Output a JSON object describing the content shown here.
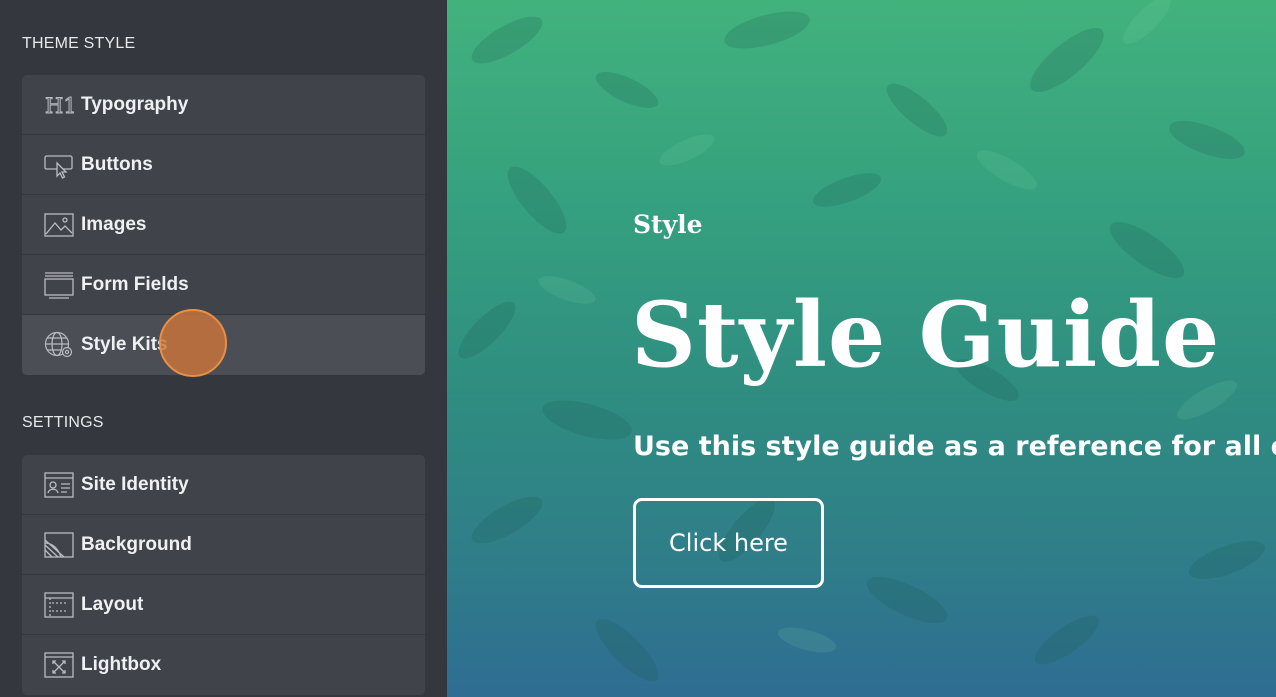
{
  "sidebar": {
    "theme_style": {
      "title": "THEME STYLE",
      "items": [
        {
          "label": "Typography",
          "icon": "heading-h1-icon"
        },
        {
          "label": "Buttons",
          "icon": "button-cursor-icon"
        },
        {
          "label": "Images",
          "icon": "image-icon"
        },
        {
          "label": "Form Fields",
          "icon": "form-field-icon"
        },
        {
          "label": "Style Kits",
          "icon": "globe-gear-icon",
          "active": true
        }
      ]
    },
    "settings": {
      "title": "SETTINGS",
      "items": [
        {
          "label": "Site Identity",
          "icon": "id-card-icon"
        },
        {
          "label": "Background",
          "icon": "background-icon"
        },
        {
          "label": "Layout",
          "icon": "layout-icon"
        },
        {
          "label": "Lightbox",
          "icon": "lightbox-expand-icon"
        }
      ]
    }
  },
  "preview": {
    "kicker": "Style",
    "headline": "Style Guide",
    "subtitle": "Use this style guide as a reference for all elem",
    "cta_label": "Click here"
  },
  "colors": {
    "sidebar_bg": "#34373d",
    "item_bg": "#404349",
    "active_item_bg": "#4b4e55",
    "click_indicator": "#cb743a",
    "preview_gradient_top": "#42b27d",
    "preview_gradient_bottom": "#2f6d92"
  }
}
